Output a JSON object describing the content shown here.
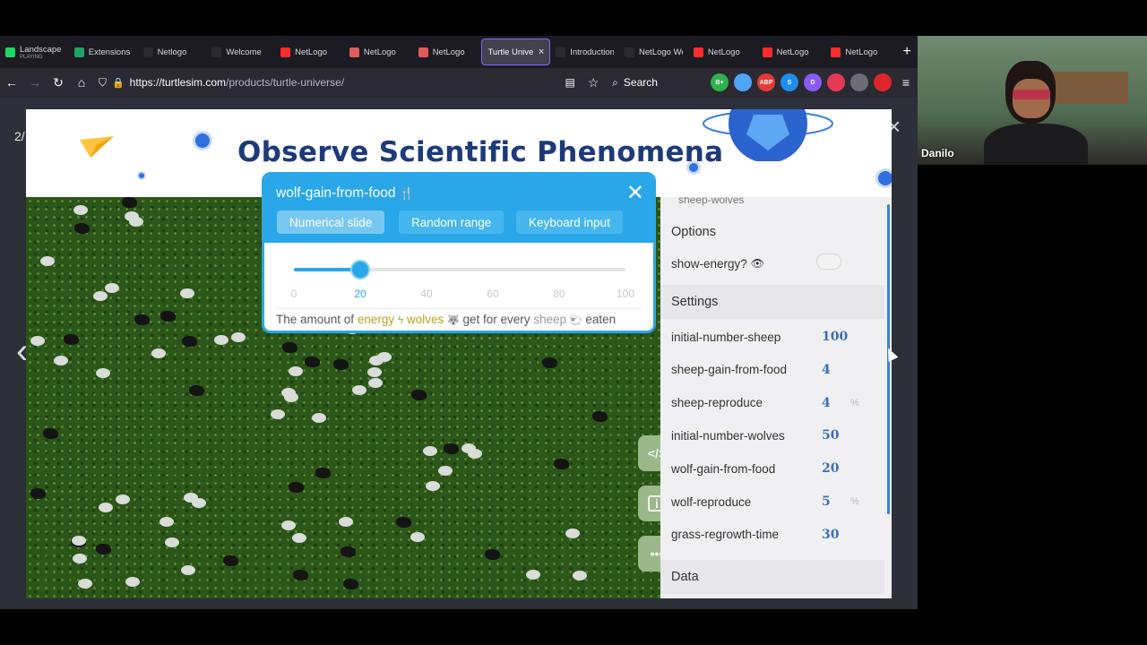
{
  "browser": {
    "tabs": [
      {
        "label": "Landscape",
        "sublabel": "PLAYING",
        "icon": "spotify-icon",
        "color": "#1ed760"
      },
      {
        "label": "Extensions",
        "icon": "sheets-icon",
        "color": "#1fa463"
      },
      {
        "label": "Netlogo",
        "icon": "blank-page-icon",
        "color": "#2b2a33"
      },
      {
        "label": "Welcome",
        "icon": "blank-page-icon",
        "color": "#2b2a33"
      },
      {
        "label": "NetLogo",
        "icon": "youtube-icon",
        "color": "#ff2d2d"
      },
      {
        "label": "NetLogo",
        "icon": "netlogo-icon",
        "color": "#e05b5b"
      },
      {
        "label": "NetLogo",
        "icon": "netlogo-icon",
        "color": "#e05b5b"
      },
      {
        "label": "Turtle Universe",
        "icon": "",
        "color": ""
      },
      {
        "label": "Introduction to",
        "icon": "blank-page-icon",
        "color": "#2b2a33"
      },
      {
        "label": "NetLogo Web",
        "icon": "blank-page-icon",
        "color": "#2b2a33"
      },
      {
        "label": "NetLogo",
        "icon": "youtube-icon",
        "color": "#ff2d2d"
      },
      {
        "label": "NetLogo",
        "icon": "youtube-icon",
        "color": "#ff2d2d"
      },
      {
        "label": "NetLogo",
        "icon": "youtube-icon",
        "color": "#ff2d2d"
      }
    ],
    "active_tab_close": "×",
    "new_tab": "+",
    "url_host": "https://turtlesim.com",
    "url_path": "/products/turtle-universe/",
    "search_placeholder": "Search",
    "extensions": [
      {
        "label": "B+",
        "color": "#2fb24c"
      },
      {
        "label": "",
        "color": "#4ea4f6"
      },
      {
        "label": "ABP",
        "color": "#e53935"
      },
      {
        "label": "S",
        "color": "#1f8ceb"
      },
      {
        "label": "D",
        "color": "#8a5cf6"
      },
      {
        "label": "",
        "color": "#e53953"
      },
      {
        "label": "",
        "color": "#6d6d78"
      },
      {
        "label": "",
        "color": "#e0262b"
      }
    ]
  },
  "slide": {
    "counter": "2/",
    "close": "×",
    "prev": "‹",
    "next": "›"
  },
  "banner": {
    "title": "Observe Scientific Phenomena"
  },
  "panel": {
    "top_cutoff": "sheep-wolves",
    "options_header": "Options",
    "show_energy_label": "show-energy?",
    "settings_header": "Settings",
    "settings": [
      {
        "name": "initial-number-sheep",
        "value": "100",
        "pct": ""
      },
      {
        "name": "sheep-gain-from-food",
        "value": "4",
        "pct": ""
      },
      {
        "name": "sheep-reproduce",
        "value": "4",
        "pct": "%"
      },
      {
        "name": "initial-number-wolves",
        "value": "50",
        "pct": ""
      },
      {
        "name": "wolf-gain-from-food",
        "value": "20",
        "pct": ""
      },
      {
        "name": "wolf-reproduce",
        "value": "5",
        "pct": "%"
      },
      {
        "name": "grass-regrowth-time",
        "value": "30",
        "pct": ""
      }
    ],
    "data_header": "Data"
  },
  "modal": {
    "title": "wolf-gain-from-food",
    "title_icon": "🍴",
    "close": "✕",
    "tabs": [
      "Numerical slide",
      "Random range",
      "Keyboard input"
    ],
    "selected_tab": 0,
    "slider_value": 20,
    "slider_min": 0,
    "slider_max": 100,
    "ticks": [
      "0",
      "20",
      "40",
      "60",
      "80",
      "100"
    ],
    "desc_prefix": "The amount of",
    "desc_energy": "energy",
    "desc_wolves": "wolves",
    "desc_mid": "get for every",
    "desc_sheep": "sheep",
    "desc_suffix": "eaten"
  },
  "side_buttons": [
    {
      "icon": "code-icon",
      "glyph": "</>"
    },
    {
      "icon": "info-icon",
      "glyph": "i"
    },
    {
      "icon": "more-icon",
      "glyph": "•••"
    }
  ],
  "webcam": {
    "name": "Danilo"
  }
}
